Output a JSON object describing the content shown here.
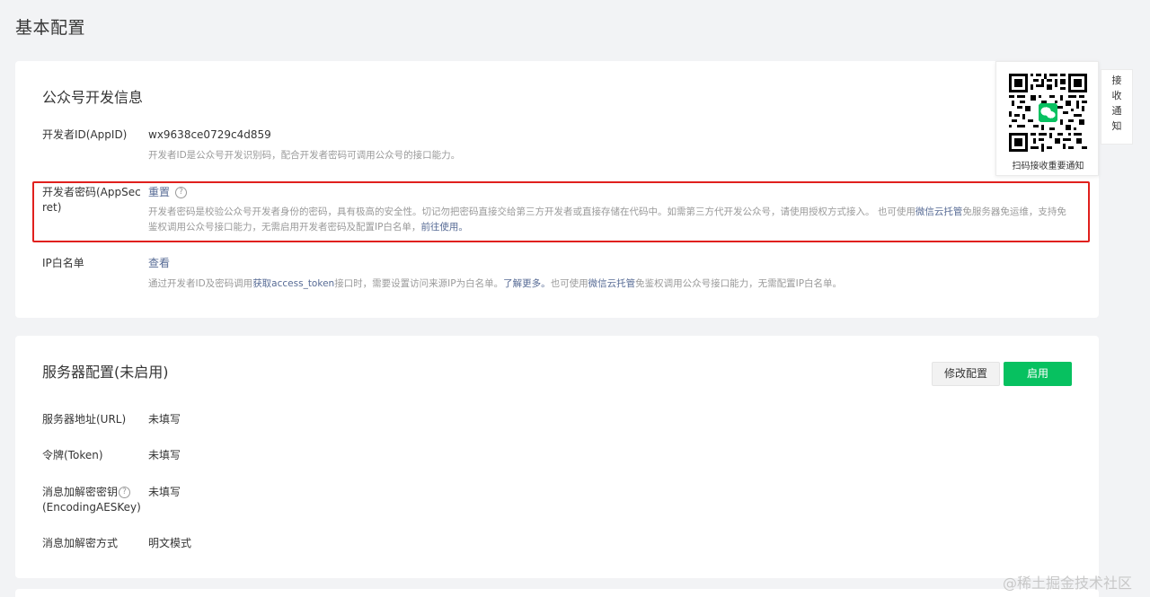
{
  "page": {
    "title": "基本配置"
  },
  "dev_info": {
    "title": "公众号开发信息",
    "appid": {
      "label": "开发者ID(AppID)",
      "value": "wx9638ce0729c4d859",
      "desc": "开发者ID是公众号开发识别码，配合开发者密码可调用公众号的接口能力。"
    },
    "appsecret": {
      "label_line1": "开发者密码(AppSec",
      "label_line2": "ret)",
      "action": "重置",
      "help": "?",
      "desc_line1_part1": "开发者密码是校验公众号开发者身份的密码，具有极高的安全性。切记勿把密码直接交给第三方开发者或直接存储在代码中。如需第三方代开发公众号，请使用授权方式接入。 也可使用",
      "desc_line1_link": "微信云托管",
      "desc_line1_part2": "免服务器免运维，支持免",
      "desc_line2_part1": "鉴权调用公众号接口能力，无需启用开发者密码及配置IP白名单，",
      "desc_line2_link": "前往使用。"
    },
    "ip_whitelist": {
      "label": "IP白名单",
      "action": "查看",
      "desc_part1": "通过开发者ID及密码调用",
      "desc_link1": "获取access_token",
      "desc_part2": "接口时，需要设置访问来源IP为白名单。",
      "desc_link2": "了解更多。",
      "desc_part3": "也可使用",
      "desc_link3": "微信云托管",
      "desc_part4": "免鉴权调用公众号接口能力，无需配置IP白名单。"
    }
  },
  "qr": {
    "caption": "扫码接收重要通知"
  },
  "notify_tab": {
    "chars": [
      "接",
      "收",
      "通",
      "知"
    ]
  },
  "server": {
    "title": "服务器配置(未启用)",
    "modify_button": "修改配置",
    "enable_button": "启用",
    "url": {
      "label": "服务器地址(URL)",
      "value": "未填写"
    },
    "token": {
      "label": "令牌(Token)",
      "value": "未填写"
    },
    "aes": {
      "label_line1": "消息加解密密钥",
      "label_line2": "(EncodingAESKey)",
      "help": "?",
      "value": "未填写"
    },
    "mode": {
      "label": "消息加解密方式",
      "value": "明文模式"
    }
  },
  "watermark": "@稀土掘金技术社区",
  "colors": {
    "accent_green": "#07c160",
    "link": "#576b95",
    "highlight": "#e0201d"
  }
}
